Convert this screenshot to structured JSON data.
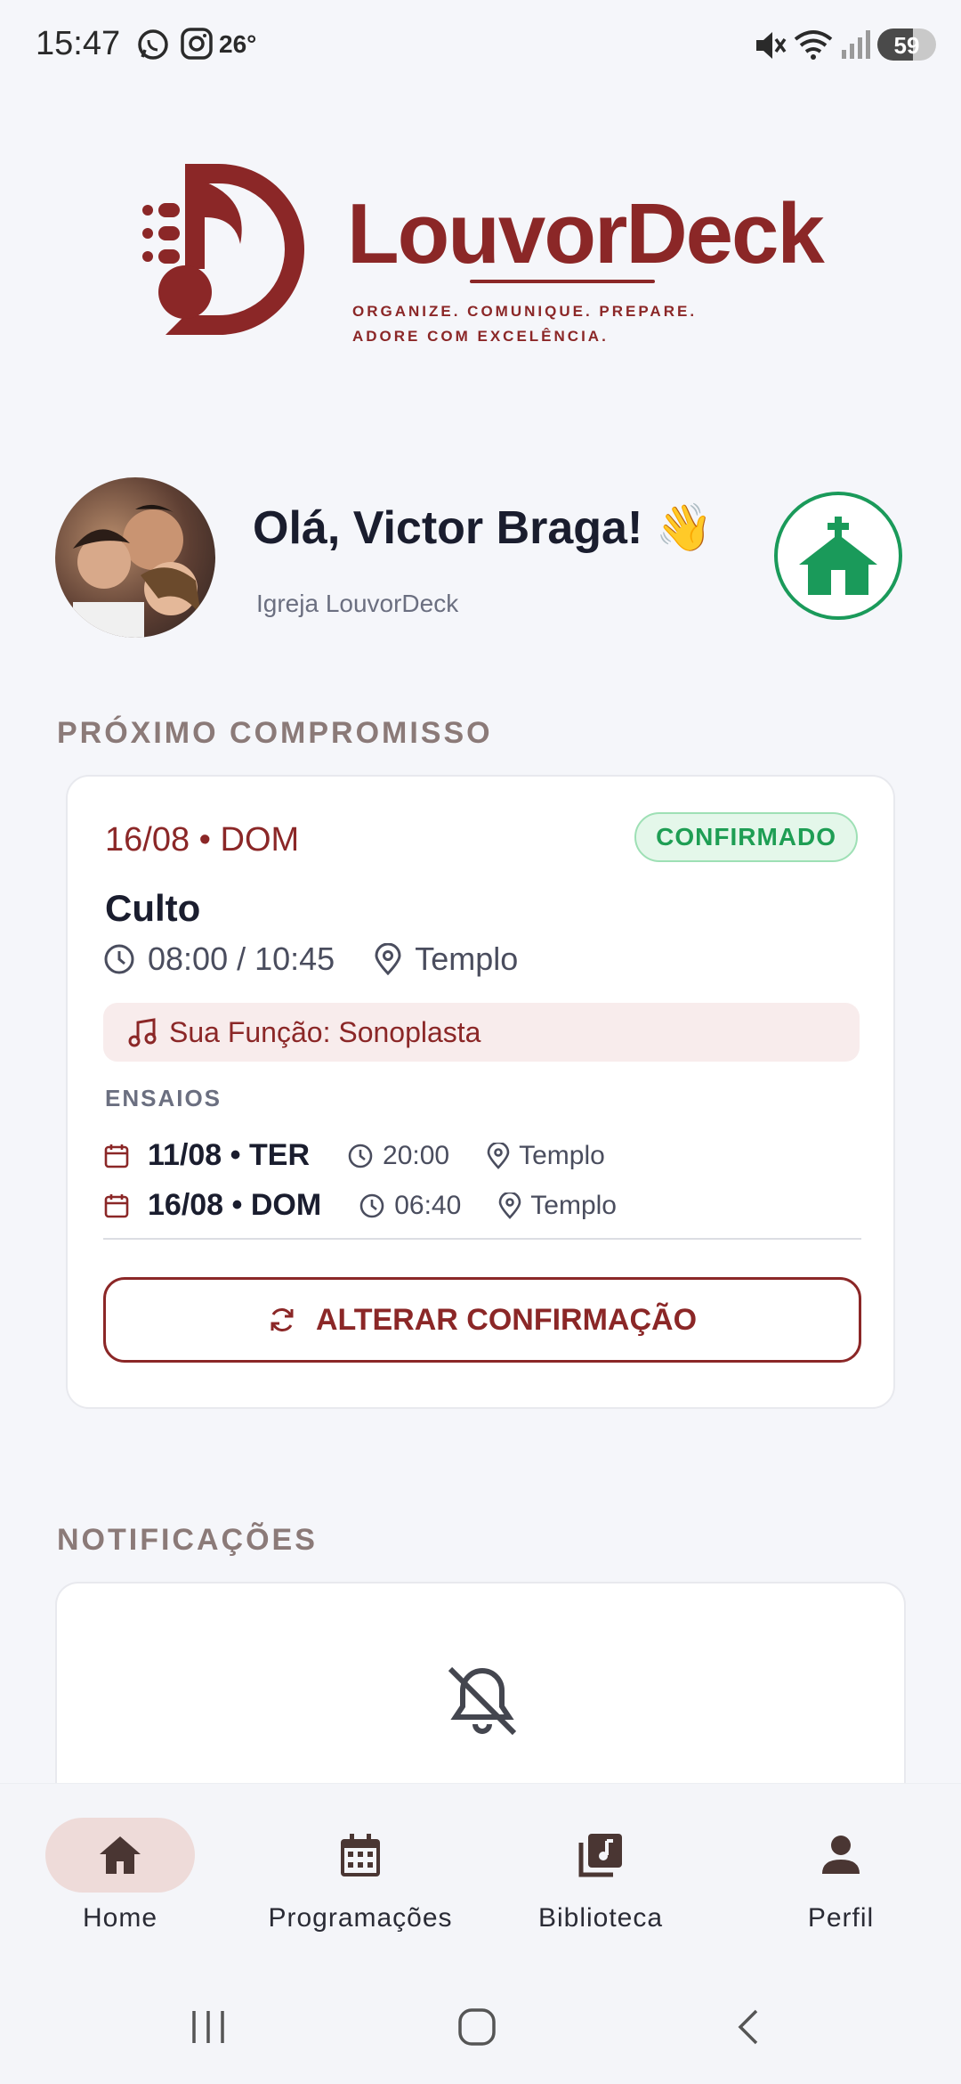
{
  "status_bar": {
    "time": "15:47",
    "temperature": "26°",
    "battery": "59"
  },
  "logo": {
    "brand": "LouvorDeck",
    "tagline_line1": "ORGANIZE. COMUNIQUE. PREPARE.",
    "tagline_line2": "ADORE COM EXCELÊNCIA."
  },
  "greeting": {
    "text": "Olá, Victor Braga! 👋",
    "church": "Igreja LouvorDeck"
  },
  "next_event": {
    "section_title": "PRÓXIMO COMPROMISSO",
    "date": "16/08 • DOM",
    "status": "CONFIRMADO",
    "title": "Culto",
    "time": "08:00 / 10:45",
    "location": "Templo",
    "role": "Sua Função: Sonoplasta",
    "rehearsals_label": "ENSAIOS",
    "rehearsals": [
      {
        "date": "11/08 • TER",
        "time": "20:00",
        "location": "Templo"
      },
      {
        "date": "16/08 • DOM",
        "time": "06:40",
        "location": "Templo"
      }
    ],
    "change_button": "ALTERAR CONFIRMAÇÃO"
  },
  "notifications": {
    "section_title": "NOTIFICAÇÕES"
  },
  "bottom_nav": [
    {
      "label": "Home",
      "icon": "home-icon",
      "active": true
    },
    {
      "label": "Programações",
      "icon": "calendar-icon",
      "active": false
    },
    {
      "label": "Biblioteca",
      "icon": "music-library-icon",
      "active": false
    },
    {
      "label": "Perfil",
      "icon": "person-icon",
      "active": false
    }
  ],
  "colors": {
    "brand": "#8b2727",
    "success": "#1e9e54",
    "church": "#1a9a5a"
  }
}
